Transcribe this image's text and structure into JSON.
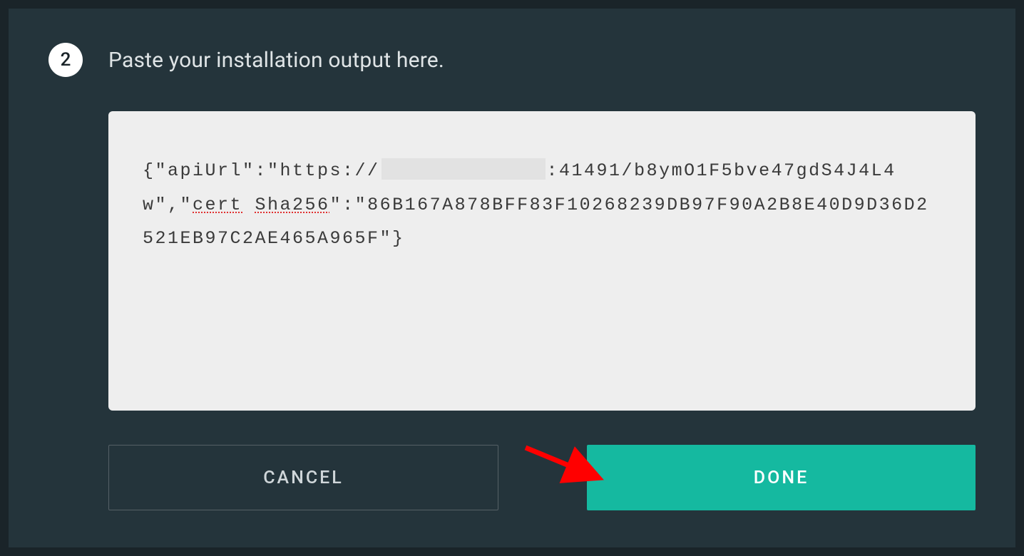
{
  "step": {
    "number": "2",
    "title": "Paste your installation output here."
  },
  "output": {
    "prefix": "{\"apiUrl\":\"https://",
    "after_redaction": ":41491/b8ymO1F5bve47gdS4J4L4w\",\"",
    "cert_word": "cert",
    "sha_word": "Sha256",
    "tail": "\":\"86B167A878BFF83F10268239DB97F90A2B8E40D9D36D2521EB97C2AE465A965F\"}"
  },
  "buttons": {
    "cancel": "CANCEL",
    "done": "DONE"
  }
}
